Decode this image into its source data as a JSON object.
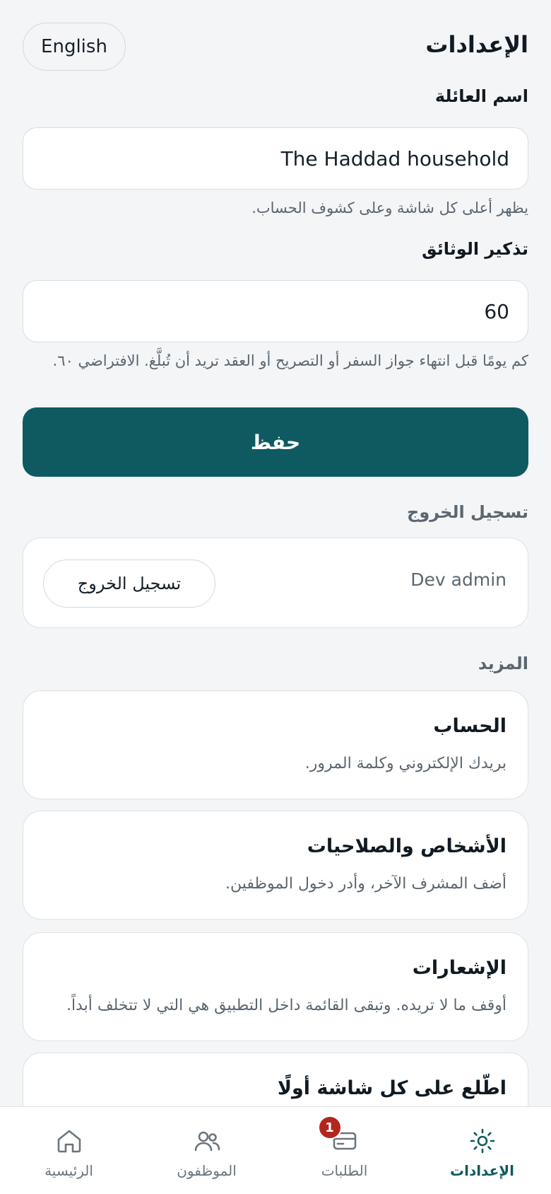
{
  "header": {
    "title": "الإعدادات",
    "language_button": "English"
  },
  "form": {
    "family_name": {
      "label": "اسم العائلة",
      "value": "The Haddad household",
      "helper": "يظهر أعلى كل شاشة وعلى كشوف الحساب."
    },
    "document_reminder": {
      "label": "تذكير الوثائق",
      "value": "60",
      "helper": "كم يومًا قبل انتهاء جواز السفر أو التصريح أو العقد تريد أن تُبلَّغ. الافتراضي ٦٠."
    },
    "save_label": "حفظ"
  },
  "logout": {
    "section_title": "تسجيل الخروج",
    "user_name": "Dev admin",
    "button_label": "تسجيل الخروج"
  },
  "more": {
    "section_title": "المزيد",
    "items": [
      {
        "title": "الحساب",
        "description": "بريدك الإلكتروني وكلمة المرور."
      },
      {
        "title": "الأشخاص والصلاحيات",
        "description": "أضف المشرف الآخر، وأدر دخول الموظفين."
      },
      {
        "title": "الإشعارات",
        "description": "أوقف ما لا تريده. وتبقى القائمة داخل التطبيق هي التي لا تتخلف أبداً."
      },
      {
        "title": "اطّلع على كل شاشة أولًا",
        "description": ""
      }
    ]
  },
  "bottom_nav": {
    "items": [
      {
        "label": "الإعدادات",
        "icon": "gear-icon",
        "active": true
      },
      {
        "label": "الطلبات",
        "icon": "card-icon",
        "badge": "1"
      },
      {
        "label": "الموظفون",
        "icon": "people-icon"
      },
      {
        "label": "الرئيسية",
        "icon": "home-icon"
      }
    ],
    "accent_color": "#0e5a60",
    "badge_color": "#b3261e"
  }
}
